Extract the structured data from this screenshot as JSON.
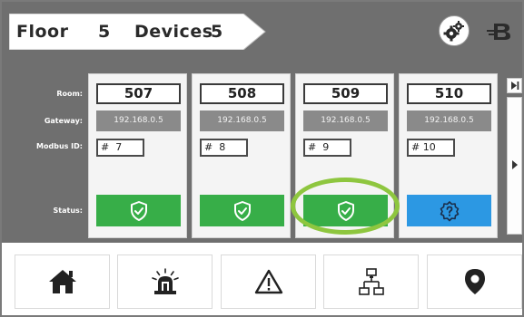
{
  "header": {
    "floor_label": "Floor",
    "floor_value": "5",
    "devices_label": "Devices",
    "devices_value": "5"
  },
  "row_labels": {
    "room": "Room:",
    "gateway": "Gateway:",
    "modbus": "Modbus ID:",
    "status": "Status:"
  },
  "devices": [
    {
      "room": "507",
      "gateway": "192.168.0.5",
      "modbus": "#  7",
      "status": "ok"
    },
    {
      "room": "508",
      "gateway": "192.168.0.5",
      "modbus": "#  8",
      "status": "ok"
    },
    {
      "room": "509",
      "gateway": "192.168.0.5",
      "modbus": "#  9",
      "status": "ok"
    },
    {
      "room": "510",
      "gateway": "192.168.0.5",
      "modbus": "# 10",
      "status": "unknown"
    }
  ],
  "nav": [
    "home-icon",
    "alarm-icon",
    "warning-icon",
    "network-icon",
    "location-pin-icon"
  ],
  "colors": {
    "status_ok": "#37ae48",
    "status_unknown": "#2c98e3",
    "highlight": "#8ec63f",
    "background": "#6f6f6f"
  }
}
